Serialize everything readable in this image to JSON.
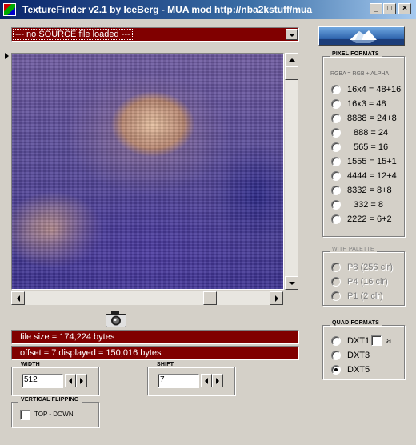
{
  "window": {
    "title": "TextureFinder v2.1 by IceBerg - MUA mod http://nba2kstuff/mua",
    "minimize": "_",
    "maximize": "□",
    "close": "×"
  },
  "source": {
    "value": "--- no SOURCE file loaded ---"
  },
  "info": {
    "file_size": "file size = 174,224 bytes",
    "offset_displayed": "offset = 7   displayed = 150,016 bytes"
  },
  "width": {
    "label": "WIDTH",
    "value": "512"
  },
  "shift": {
    "label": "SHIFT",
    "value": "7"
  },
  "vertical_flipping": {
    "label": "VERTICAL FLIPPING",
    "option": "TOP - DOWN",
    "checked": false
  },
  "pixel_formats": {
    "title": "PIXEL FORMATS",
    "subtitle": "RGBA = RGB + ALPHA",
    "options": [
      "16x4 = 48+16",
      "16x3 = 48",
      "8888 = 24+8",
      "888 = 24",
      "565 = 16",
      "1555 = 15+1",
      "4444 = 12+4",
      "8332 = 8+8",
      "332 = 8",
      "2222 = 6+2"
    ]
  },
  "palette": {
    "title": "WITH PALETTE",
    "options": [
      "P8  (256 clr)",
      "P4  (16 clr)",
      "P1  (2 clr)"
    ]
  },
  "quad_formats": {
    "title": "QUAD FORMATS",
    "options": [
      "DXT1",
      "DXT3",
      "DXT5"
    ],
    "alpha_label": "a",
    "selected": "DXT5"
  },
  "icons": {
    "app": "app-icon",
    "camera": "camera-icon",
    "logo": "iceberg-logo"
  },
  "colors": {
    "title_bar": "#0a246a",
    "info_bar": "#800000",
    "face": "#d4d0c8"
  }
}
